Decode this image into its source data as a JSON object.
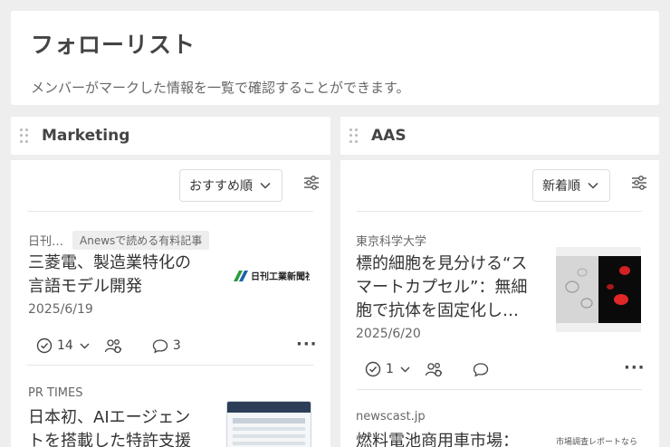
{
  "header": {
    "title": "フォローリスト",
    "description": "メンバーがマークした情報を一覧で確認することができます。"
  },
  "columns": [
    {
      "title": "Marketing",
      "sort_label": "おすすめ順",
      "cards": [
        {
          "source": "日刊…",
          "badge": "Anewsで読める有料記事",
          "title_line1": "三菱電、製造業特化の",
          "title_line2": "言語モデル開発",
          "date": "2025/6/19",
          "check_count": "14",
          "comment_count": "3",
          "thumb_logo": "日刊工業新聞社"
        },
        {
          "source": "PR TIMES",
          "title_line1": "日本初、AIエージェン",
          "title_line2": "トを搭載した特許支援"
        }
      ]
    },
    {
      "title": "AAS",
      "sort_label": "新着順",
      "cards": [
        {
          "source": "東京科学大学",
          "title_line1": "標的細胞を見分ける“ス",
          "title_line2": "マートカプセル”：無細",
          "title_line3": "胞で抗体を固定化し…",
          "date": "2025/6/20",
          "check_count": "1"
        },
        {
          "source": "newscast.jp",
          "title_line1": "燃料電池商用車市場：",
          "thumb_text": "市場調査レポートなら"
        }
      ]
    }
  ]
}
